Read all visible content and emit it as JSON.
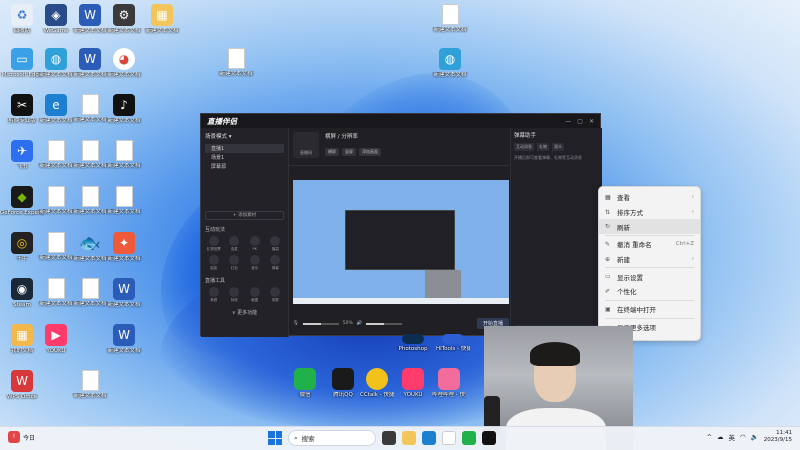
{
  "desktop": {
    "icons": [
      {
        "label": "回收站",
        "color": "#e8eef6",
        "glyph": "♻"
      },
      {
        "label": "Microsoft Edge",
        "color": "#1d7fd0",
        "glyph": "e"
      },
      {
        "label": "剪映专业版",
        "color": "#111111",
        "glyph": "✂"
      },
      {
        "label": "飞书",
        "color": "#2e6ff0",
        "glyph": "✈"
      },
      {
        "label": "GeForce Experience",
        "color": "#1a1a1a",
        "glyph": "◆"
      },
      {
        "label": "千牛",
        "color": "#222222",
        "glyph": "◎"
      },
      {
        "label": "Steam",
        "color": "#1b2838",
        "glyph": "◉"
      },
      {
        "label": "我的文档",
        "color": "#f2b84b",
        "glyph": "▦"
      },
      {
        "label": "WPS Office",
        "color": "#d9383b",
        "glyph": "W"
      }
    ],
    "col2_icons": [
      {
        "label": "WeGame",
        "color": "#2a4b8a"
      },
      {
        "label": "新建文本文档",
        "color": "#ffffff"
      },
      {
        "label": "新建文本文档",
        "color": "#ffffff"
      },
      {
        "label": "新建文本文档",
        "color": "#ffffff"
      },
      {
        "label": "新建文本文档",
        "color": "#ffffff"
      },
      {
        "label": "新建文本文档",
        "color": "#ffffff"
      },
      {
        "label": "新建文本文档",
        "color": "#ffffff"
      },
      {
        "label": "YOUKU",
        "color": "#ff3b6b"
      }
    ],
    "text_doc_label": "新建文本文档"
  },
  "window": {
    "app_name": "直播伴侣",
    "scene_header": "场景模式 ▾",
    "scene_items": [
      "直播1",
      "场景1",
      "屏幕源"
    ],
    "add_scene": "+ 添加素材",
    "section_interact": "互动玩法",
    "section_tools": "直播工具",
    "tool_labels": [
      "礼物投票",
      "连麦",
      "PK",
      "福袋",
      "抽奖",
      "红包",
      "音乐",
      "弹幕",
      "美颜",
      "特效",
      "截图",
      "录屏"
    ],
    "more_label": "∨ 更多功能",
    "preview_tab": "直播间",
    "top_tabs": [
      "横屏",
      "竖屏",
      "添加画面"
    ],
    "room_title": "横屏 / 分辨率",
    "volume_pct": "50%",
    "live_button": "开始直播",
    "right_title": "弹幕助手",
    "right_tabs": [
      "互动消息",
      "礼物",
      "观众"
    ],
    "right_text": "开播后即可查看弹幕、礼物等互动消息"
  },
  "context_menu": {
    "items": [
      {
        "icon": "▦",
        "label": "查看",
        "shortcut": "›"
      },
      {
        "icon": "⇅",
        "label": "排序方式",
        "shortcut": "›"
      },
      {
        "icon": "↻",
        "label": "刷新",
        "shortcut": ""
      },
      {
        "icon": "✎",
        "label": "撤消 重命名",
        "shortcut": "Ctrl+Z"
      },
      {
        "icon": "⊕",
        "label": "新建",
        "shortcut": "›"
      },
      {
        "icon": "▭",
        "label": "显示设置",
        "shortcut": ""
      },
      {
        "icon": "✐",
        "label": "个性化",
        "shortcut": ""
      },
      {
        "icon": "▣",
        "label": "在终端中打开",
        "shortcut": ""
      },
      {
        "icon": "⋯",
        "label": "显示更多选项",
        "shortcut": ""
      }
    ]
  },
  "mid_apps": [
    {
      "label": "微信",
      "color": "#20b14a"
    },
    {
      "label": "腾讯QQ",
      "color": "#1a1a1a"
    },
    {
      "label": "CCtalk - 快捷方式",
      "color": "#f2c21a"
    },
    {
      "label": "YOUKU",
      "color": "#ff3b6b"
    },
    {
      "label": "哔哩哔哩 - 快捷方式",
      "color": "#f26d9b"
    },
    {
      "label": "Photoshop",
      "color": "#0c2d4f"
    },
    {
      "label": "HiTools - 快捷方式",
      "color": "#2d5fd3"
    }
  ],
  "taskbar": {
    "weather_label": "今日",
    "search_placeholder": "搜索",
    "lang": "英",
    "time": "11:41",
    "date": "2023/9/15"
  }
}
